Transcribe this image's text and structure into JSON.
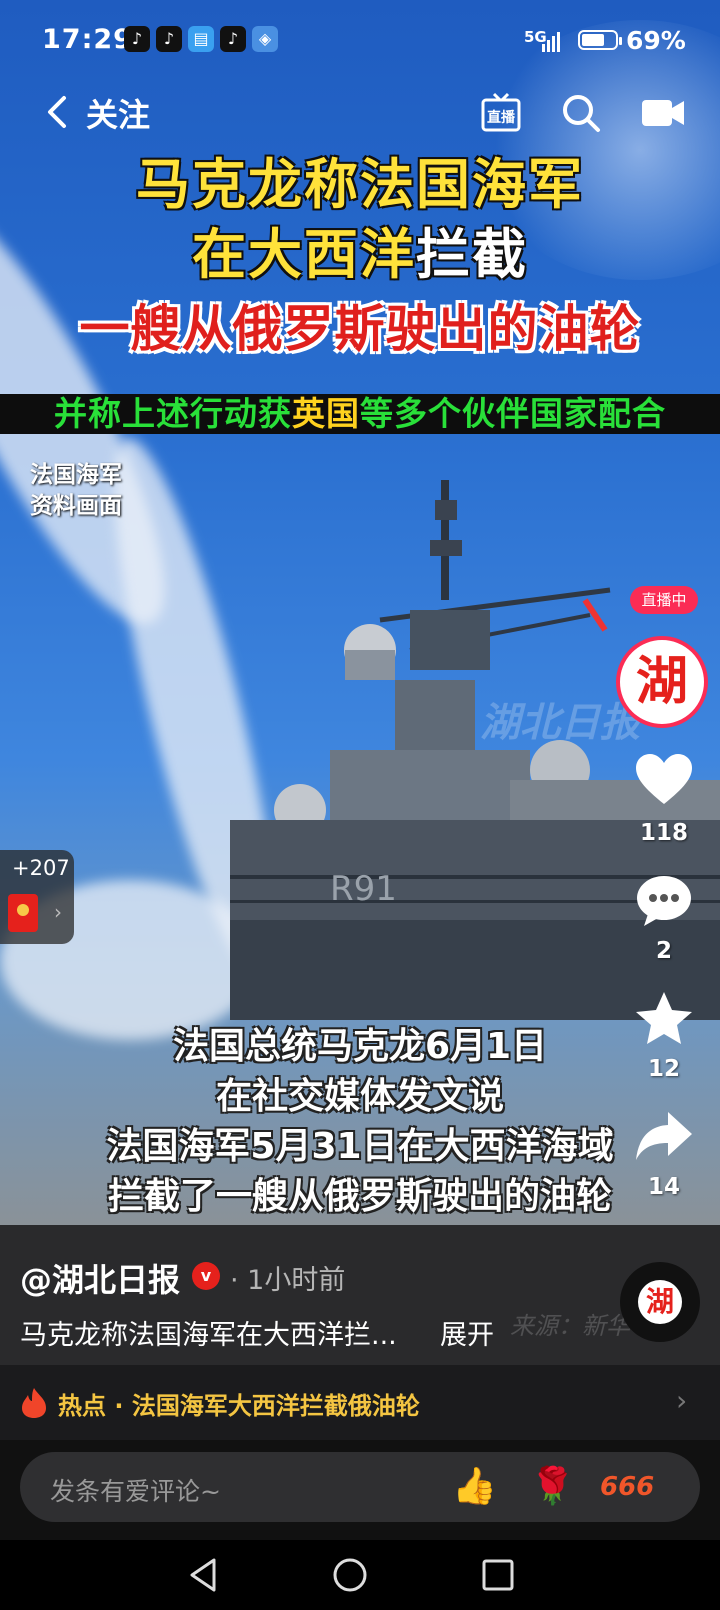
{
  "status_bar": {
    "time": "17:29",
    "network": "5G",
    "battery": "69%",
    "battery_level": 0.69
  },
  "nav": {
    "title": "关注",
    "live_label": "直播"
  },
  "video": {
    "headline_line1": "马克龙称法国海军",
    "headline_line2_a": "在大西洋",
    "headline_line2_b": "拦截",
    "headline_line3": "一艘从俄罗斯驶出的油轮",
    "headline_line4_a": "并称上述行动获",
    "headline_line4_b": "英国",
    "headline_line4_c": "等多个伙伴国家配合",
    "archive_line1": "法国海军",
    "archive_line2": "资料画面",
    "watermark": "湖北日报",
    "hull_number": "R91",
    "subtitles": [
      "法国总统马克龙6月1日",
      "在社交媒体发文说",
      "法国海军5月31日在大西洋海域",
      "拦截了一艘从俄罗斯驶出的油轮"
    ]
  },
  "rail": {
    "live_tag": "直播中",
    "avatar_char": "湖",
    "likes": "118",
    "comments": "2",
    "favorites": "12",
    "shares": "14"
  },
  "packet": {
    "count": "+207"
  },
  "info": {
    "author": "@湖北日报",
    "verified": "v",
    "time": "· 1小时前",
    "description": "马克龙称法国海军在大西洋拦...",
    "expand": "展开",
    "source_watermark": "来源：新华"
  },
  "hot": {
    "text": "热点 · 法国海军大西洋拦截俄油轮"
  },
  "comment": {
    "placeholder": "发条有爱评论~",
    "emoji": [
      "👍",
      "🌹",
      "666"
    ]
  },
  "colors": {
    "accent_red": "#fb2c55",
    "headline_yellow": "#ffe23a",
    "headline_red": "#e0201d",
    "green_banner": "#29e039",
    "hot_text": "#f4c542"
  }
}
